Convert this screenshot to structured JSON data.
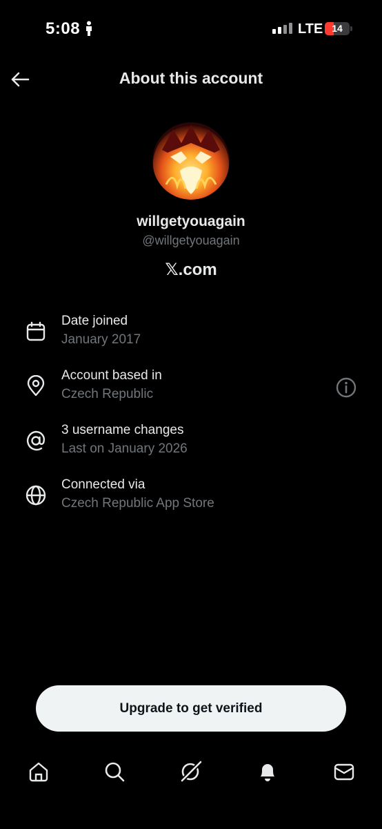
{
  "status_bar": {
    "time": "5:08",
    "network": "LTE",
    "battery_level": "14",
    "battery_fraction": 0.14
  },
  "header": {
    "title": "About this account",
    "back_icon": "arrow-left-icon"
  },
  "profile": {
    "display_name": "willgetyouagain",
    "handle": "@willgetyouagain",
    "platform": "𝕏.com",
    "avatar_icon": "flaming-skull-avatar"
  },
  "info": [
    {
      "icon": "calendar-icon",
      "title": "Date joined",
      "subtitle": "January 2017"
    },
    {
      "icon": "location-pin-icon",
      "title": "Account based in",
      "subtitle": "Czech Republic",
      "action_icon": "info-icon"
    },
    {
      "icon": "at-sign-icon",
      "title": "3 username changes",
      "subtitle": "Last on January 2026"
    },
    {
      "icon": "globe-icon",
      "title": "Connected via",
      "subtitle": "Czech Republic App Store"
    }
  ],
  "upgrade": {
    "label": "Upgrade to get verified"
  },
  "nav": [
    {
      "icon": "home-icon"
    },
    {
      "icon": "search-icon"
    },
    {
      "icon": "grok-icon"
    },
    {
      "icon": "notifications-bell-icon"
    },
    {
      "icon": "messages-icon"
    }
  ],
  "colors": {
    "background": "#000000",
    "primary_text": "#e7e9ea",
    "secondary_text": "#71767b",
    "button_bg": "#eff3f4",
    "battery_low": "#ff3b30"
  }
}
